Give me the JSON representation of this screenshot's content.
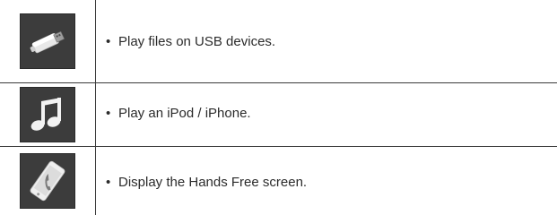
{
  "rows": [
    {
      "icon": "usb-drive-icon",
      "bullet": "•",
      "text": "Play files on USB devices."
    },
    {
      "icon": "music-note-icon",
      "bullet": "•",
      "text": "Play an iPod / iPhone."
    },
    {
      "icon": "phone-icon",
      "bullet": "•",
      "text": "Display the Hands Free screen."
    }
  ]
}
